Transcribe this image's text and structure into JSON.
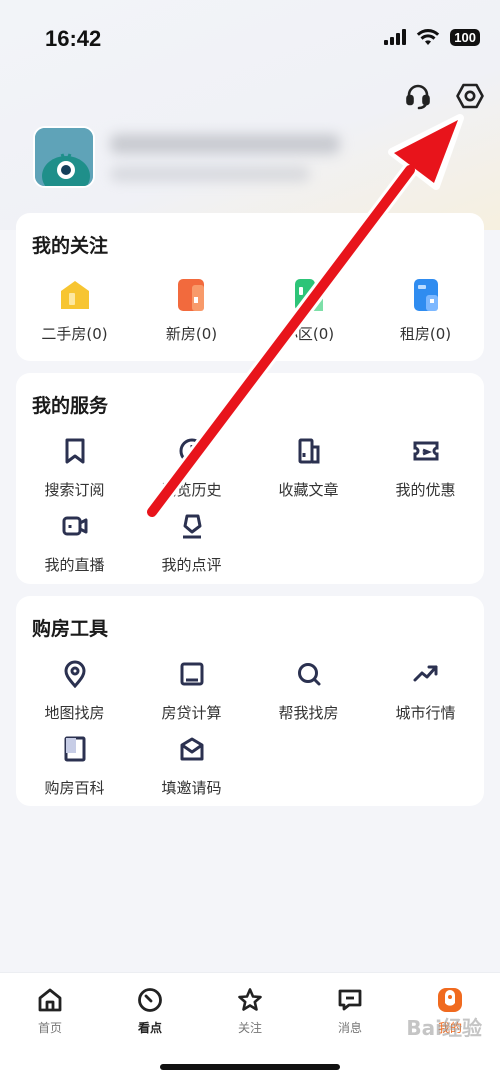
{
  "status_bar": {
    "time": "16:42",
    "battery": "100"
  },
  "top_actions": {
    "support_icon": "headset-icon",
    "settings_icon": "settings-hexagon-icon"
  },
  "follow_section": {
    "title": "我的关注",
    "items": [
      {
        "label": "二手房(0)",
        "icon": "house-icon",
        "color": "#f7c531"
      },
      {
        "label": "新房(0)",
        "icon": "building-icon",
        "color": "#f26a3d"
      },
      {
        "label": "小区(0)",
        "icon": "community-icon",
        "color": "#2dc478"
      },
      {
        "label": "租房(0)",
        "icon": "rent-icon",
        "color": "#2f8cf0"
      }
    ]
  },
  "service_section": {
    "title": "我的服务",
    "items": [
      {
        "label": "搜索订阅",
        "icon": "bookmark-icon"
      },
      {
        "label": "浏览历史",
        "icon": "history-icon"
      },
      {
        "label": "收藏文章",
        "icon": "article-icon"
      },
      {
        "label": "我的优惠",
        "icon": "coupon-icon"
      },
      {
        "label": "我的直播",
        "icon": "live-video-icon"
      },
      {
        "label": "我的点评",
        "icon": "review-icon"
      }
    ]
  },
  "tools_section": {
    "title": "购房工具",
    "items": [
      {
        "label": "地图找房",
        "icon": "map-pin-icon"
      },
      {
        "label": "房贷计算",
        "icon": "calculator-icon"
      },
      {
        "label": "帮我找房",
        "icon": "search-icon"
      },
      {
        "label": "城市行情",
        "icon": "trend-icon"
      },
      {
        "label": "购房百科",
        "icon": "encyclopedia-icon"
      },
      {
        "label": "填邀请码",
        "icon": "envelope-icon"
      }
    ]
  },
  "tabbar": {
    "items": [
      {
        "label": "首页",
        "icon": "home-icon"
      },
      {
        "label": "看点",
        "icon": "compass-icon"
      },
      {
        "label": "关注",
        "icon": "star-icon"
      },
      {
        "label": "消息",
        "icon": "message-icon"
      },
      {
        "label": "我的",
        "icon": "profile-icon"
      }
    ],
    "active_color": "#f06a1f"
  },
  "accent_arrow_color": "#e8141b"
}
